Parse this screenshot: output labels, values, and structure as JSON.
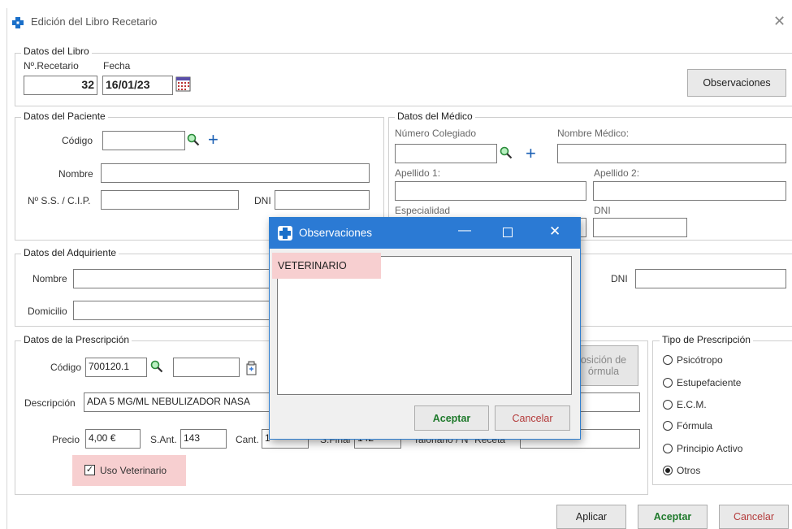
{
  "window": {
    "title": "Edición del Libro Recetario",
    "close_icon": "close-icon"
  },
  "datos_libro": {
    "title": "Datos del Libro",
    "num_label": "Nº.Recetario",
    "num_value": "32",
    "fecha_label": "Fecha",
    "fecha_value": "16/01/23",
    "observaciones_button": "Observaciones"
  },
  "paciente": {
    "title": "Datos del Paciente",
    "codigo_label": "Código",
    "codigo_value": "",
    "nombre_label": "Nombre",
    "nombre_value": "",
    "ss_label": "Nº S.S. / C.I.P.",
    "ss_value": "",
    "dni_label": "DNI",
    "dni_value": ""
  },
  "medico": {
    "title": "Datos del Médico",
    "colegiado_label": "Número Colegiado",
    "colegiado_value": "",
    "nombre_label": "Nombre Médico:",
    "nombre_value": "",
    "apellido1_label": "Apellido 1:",
    "apellido1_value": "",
    "apellido2_label": "Apellido 2:",
    "apellido2_value": "",
    "especialidad_label": "Especialidad",
    "especialidad_value": "",
    "dni_label": "DNI",
    "dni_value": ""
  },
  "adquiriente": {
    "title": "Datos del Adquiriente",
    "nombre_label": "Nombre",
    "nombre_value": "",
    "domicilio_label": "Domicilio",
    "domicilio_value": "",
    "dni_label": "DNI",
    "dni_value": ""
  },
  "prescripcion": {
    "title": "Datos de la Prescripción",
    "codigo_label": "Código",
    "codigo_value": "700120.1",
    "codigo2_value": "",
    "descripcion_label": "Descripción",
    "descripcion_value": "ADA 5 MG/ML NEBULIZADOR NASA",
    "precio_label": "Precio",
    "precio_value": "4,00 €",
    "sant_label": "S.Ant.",
    "sant_value": "143",
    "cant_label": "Cant.",
    "cant_value": "1",
    "sfinal_label": "S.Final",
    "sfinal_value": "142",
    "talonario_label": "Talonario / Nº Receta",
    "talonario_value": "",
    "uso_veterinario_label": "Uso Veterinario",
    "uso_veterinario_checked": true,
    "composicion_line1": "osición de",
    "composicion_line2": "órmula"
  },
  "tipo_prescripcion": {
    "title": "Tipo de Prescripción",
    "options": [
      "Psicótropo",
      "Estupefaciente",
      "E.C.M.",
      "Fórmula",
      "Principio Activo",
      "Otros"
    ],
    "selected": "Otros"
  },
  "footer": {
    "aplicar": "Aplicar",
    "aceptar": "Aceptar",
    "cancelar": "Cancelar"
  },
  "dialog": {
    "title": "Observaciones",
    "text": "VETERINARIO",
    "aceptar": "Aceptar",
    "cancelar": "Cancelar"
  },
  "colors": {
    "accent": "#2b7ad4",
    "ok": "#1f7a2c",
    "cancel": "#b43b3b",
    "highlight": "#f7cfd0"
  }
}
